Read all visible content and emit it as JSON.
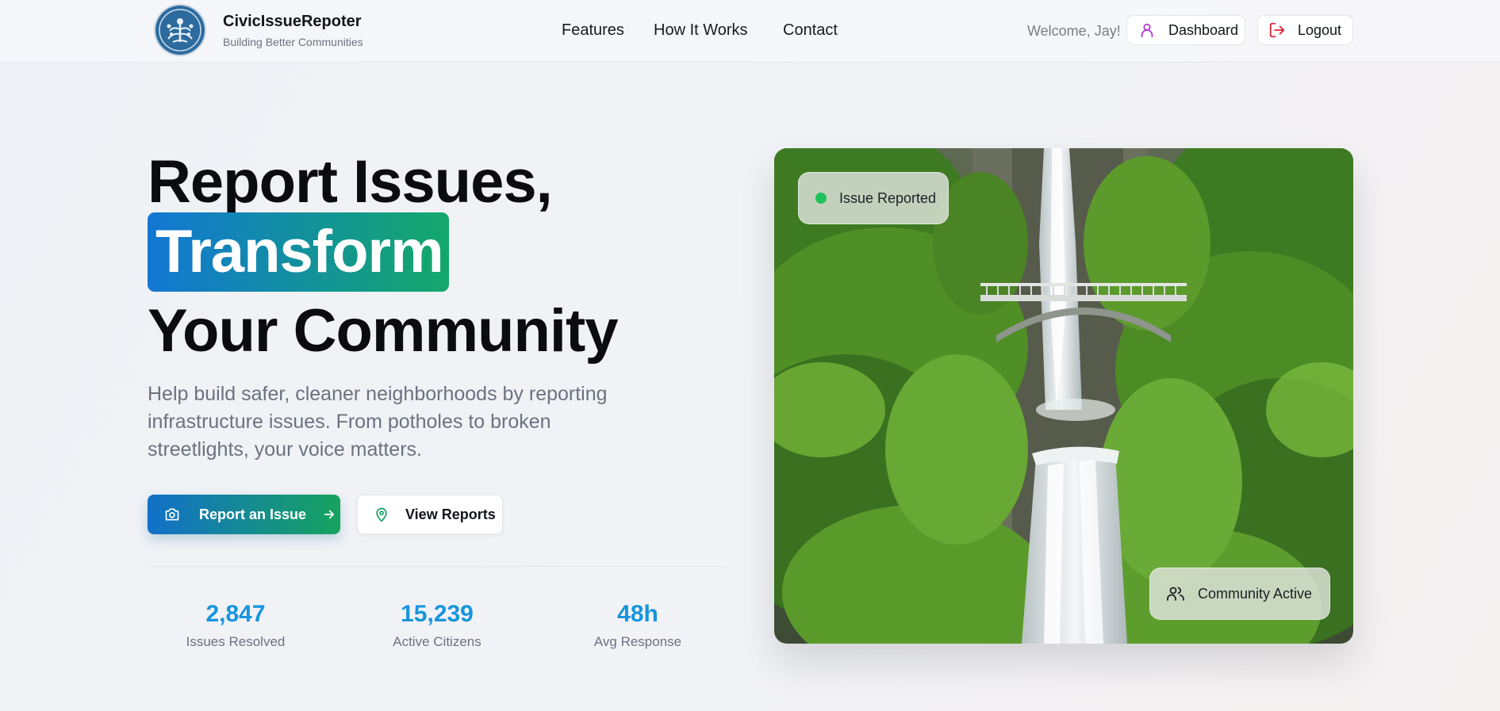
{
  "brand": {
    "name": "CivicIssueRepoter",
    "tagline": "Building Better Communities"
  },
  "nav": {
    "items": [
      {
        "label": "Features"
      },
      {
        "label": "How It Works"
      },
      {
        "label": "Contact"
      }
    ]
  },
  "user": {
    "welcome": "Welcome, Jay!",
    "dashboard_label": "Dashboard",
    "logout_label": "Logout"
  },
  "hero": {
    "headline_line1": "Report Issues,",
    "headline_highlight": "Transform",
    "headline_line3": "Your Community",
    "description": "Help build safer, cleaner neighborhoods by reporting infrastructure issues. From potholes to broken streetlights, your voice matters.",
    "primary_button": "Report an Issue",
    "secondary_button": "View Reports"
  },
  "stats": [
    {
      "value": "2,847",
      "label": "Issues Resolved"
    },
    {
      "value": "15,239",
      "label": "Active Citizens"
    },
    {
      "value": "48h",
      "label": "Avg Response"
    }
  ],
  "image_card": {
    "top_badge": "Issue Reported",
    "bottom_badge": "Community Active",
    "status_color": "#1fc15b"
  },
  "colors": {
    "gradient_start": "#1277d4",
    "gradient_end": "#14a86a",
    "stat_value": "#1795de",
    "dashboard_icon": "#b23ad6",
    "logout_icon": "#e0243a",
    "location_icon": "#17a35e"
  },
  "icons": {
    "logo": "tree-of-life-icon",
    "dashboard": "user-icon",
    "logout": "logout-icon",
    "report": "camera-icon",
    "arrow": "arrow-right-icon",
    "view_reports": "map-pin-icon",
    "community": "users-icon"
  }
}
